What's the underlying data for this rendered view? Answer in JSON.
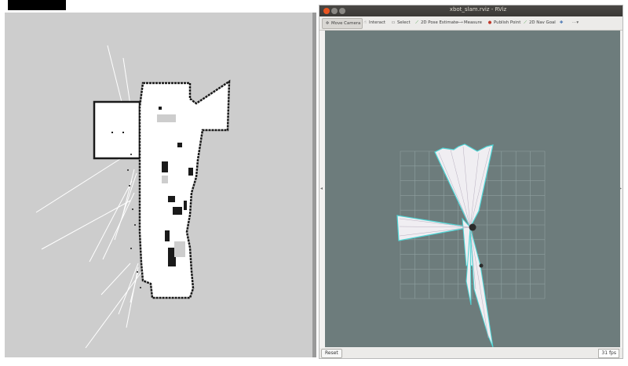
{
  "window": {
    "title": "xbot_slam.rviz - RViz"
  },
  "toolbar": {
    "tools": [
      {
        "label": "Move Camera",
        "icon": "move-camera-icon"
      },
      {
        "label": "Interact",
        "icon": "interact-icon"
      },
      {
        "label": "Select",
        "icon": "select-icon"
      },
      {
        "label": "2D Pose Estimate",
        "icon": "pose-estimate-icon"
      },
      {
        "label": "Measure",
        "icon": "measure-icon"
      },
      {
        "label": "Publish Point",
        "icon": "publish-point-icon"
      },
      {
        "label": "2D Nav Goal",
        "icon": "nav-goal-icon"
      }
    ],
    "add_icon": "add-tool-icon",
    "menu_icon": "tool-menu-icon"
  },
  "bottom": {
    "reset_label": "Reset",
    "fps_label": "31 fps"
  },
  "colors": {
    "viewport_bg": "#6d7c7c",
    "map_bg": "#cdcdcd",
    "free_space": "#ffffff",
    "obstacle": "#000000",
    "laser_cyan": "#4fd6d6",
    "grid": "#8fa0a0",
    "accent_close": "#e95420"
  }
}
